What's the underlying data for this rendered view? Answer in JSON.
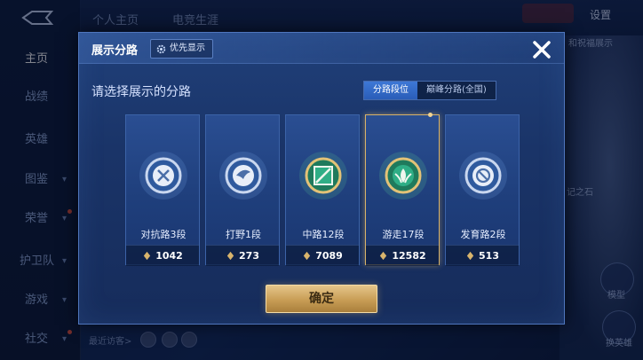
{
  "sidebar": {
    "items": [
      {
        "label": "主页",
        "active": true
      },
      {
        "label": "战绩"
      },
      {
        "label": "英雄"
      },
      {
        "label": "图鉴",
        "chevron": true
      },
      {
        "label": "荣誉",
        "chevron": true,
        "dot": true
      },
      {
        "label": "护卫队",
        "chevron": true
      },
      {
        "label": "游戏",
        "chevron": true
      },
      {
        "label": "社交",
        "chevron": true,
        "dot": true
      }
    ]
  },
  "topbar": {
    "tabs": [
      "个人主页",
      "电竞生涯"
    ],
    "settings_label": "设置"
  },
  "background": {
    "right_text_1": "和祝福展示",
    "right_text_2": "记之石",
    "model_label": "模型",
    "change_hero_label": "换英雄",
    "recent_visitors_label": "最近访客>"
  },
  "modal": {
    "title": "展示分路",
    "priority_label": "优先显示",
    "subtitle": "请选择展示的分路",
    "tabs": [
      {
        "label": "分路段位",
        "active": true
      },
      {
        "label": "巅峰分路(全国)",
        "active": false
      }
    ],
    "cards": [
      {
        "label": "对抗路3段",
        "value": "1042",
        "theme": "silver",
        "selected": false
      },
      {
        "label": "打野1段",
        "value": "273",
        "theme": "silver",
        "selected": false
      },
      {
        "label": "中路12段",
        "value": "7089",
        "theme": "green-gold",
        "selected": false
      },
      {
        "label": "游走17段",
        "value": "12582",
        "theme": "green-gold",
        "selected": true
      },
      {
        "label": "发育路2段",
        "value": "513",
        "theme": "silver",
        "selected": false
      }
    ],
    "confirm_label": "确定"
  },
  "colors": {
    "accent_blue": "#2a5db8",
    "gold": "#c89d55",
    "selected_border": "#d7b26a"
  }
}
